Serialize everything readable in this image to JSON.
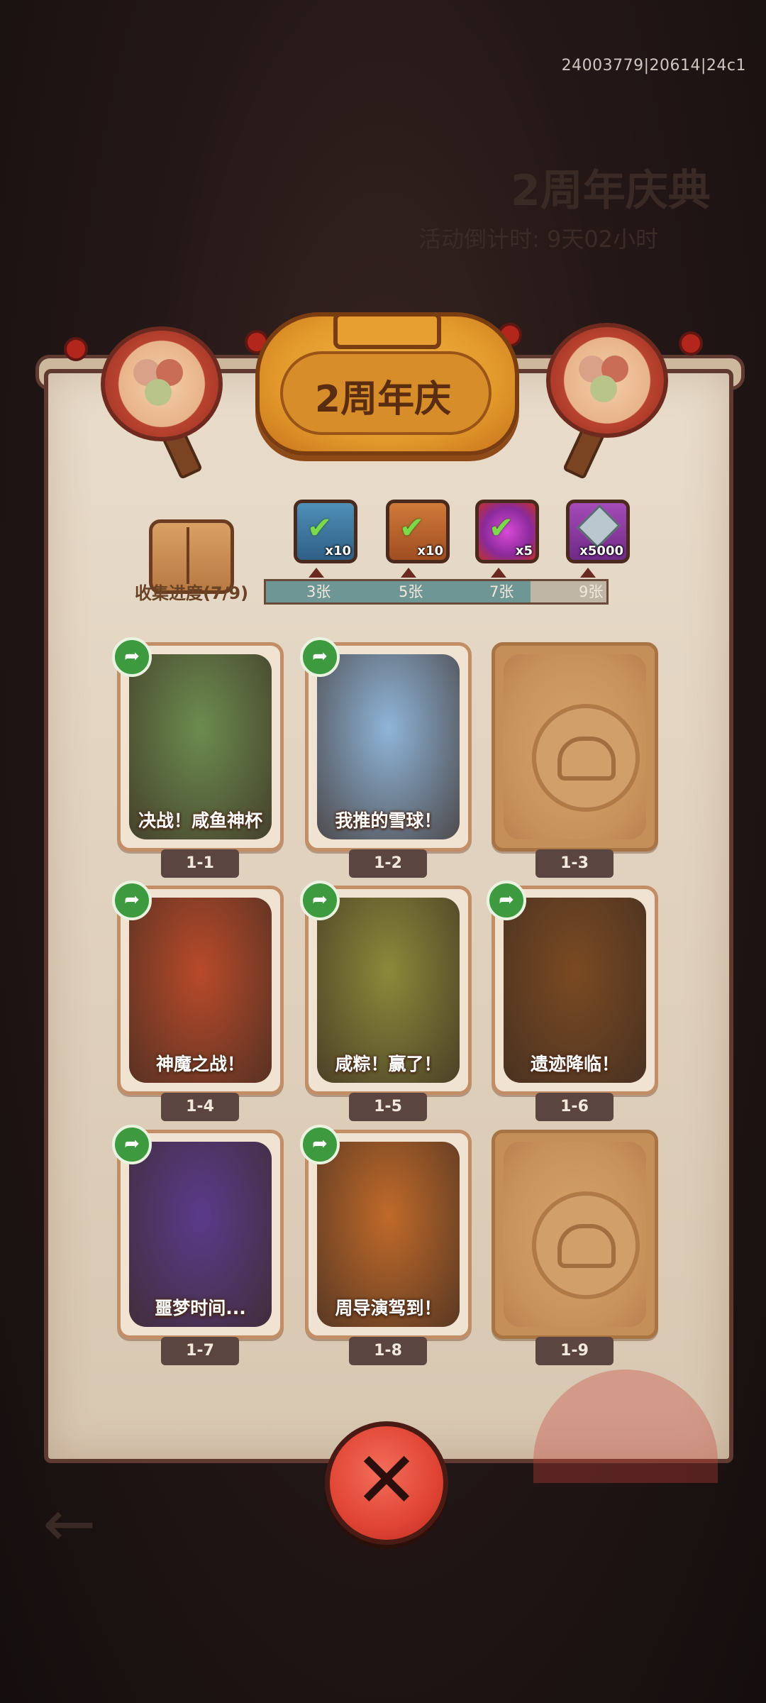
{
  "build_id": "24003779|20614|24c1",
  "background": {
    "title": "2周年庆典",
    "subtitle": "活动倒计时: 9天02小时"
  },
  "event_title": "2周年庆",
  "progress": {
    "label": "收集进度(7/9)",
    "collected": 7,
    "total": 9,
    "milestones": [
      {
        "label": "3张",
        "reward_qty": "x10",
        "claimed": true,
        "reward_icon": "blue-chest-check-icon"
      },
      {
        "label": "5张",
        "reward_qty": "x10",
        "claimed": true,
        "reward_icon": "orange-scroll-check-icon"
      },
      {
        "label": "7张",
        "reward_qty": "x5",
        "claimed": true,
        "reward_icon": "purple-orb-check-icon"
      },
      {
        "label": "9张",
        "reward_qty": "x5000",
        "claimed": false,
        "reward_icon": "purple-crystal-icon"
      }
    ]
  },
  "cards": [
    {
      "id": "1-1",
      "title": "决战！咸鱼神杯",
      "unlocked": true,
      "color": "#6c8c4f"
    },
    {
      "id": "1-2",
      "title": "我推的雪球！",
      "unlocked": true,
      "color": "#8fb5d8"
    },
    {
      "id": "1-3",
      "title": "",
      "unlocked": false,
      "color": "#c8925c"
    },
    {
      "id": "1-4",
      "title": "神魔之战！",
      "unlocked": true,
      "color": "#b84a2a"
    },
    {
      "id": "1-5",
      "title": "咸粽！赢了！",
      "unlocked": true,
      "color": "#8a8a3a"
    },
    {
      "id": "1-6",
      "title": "遗迹降临！",
      "unlocked": true,
      "color": "#7a4a22"
    },
    {
      "id": "1-7",
      "title": "噩梦时间...",
      "unlocked": true,
      "color": "#5a3a8a"
    },
    {
      "id": "1-8",
      "title": "周导演驾到！",
      "unlocked": true,
      "color": "#c06a2a"
    },
    {
      "id": "1-9",
      "title": "",
      "unlocked": false,
      "color": "#c8925c"
    }
  ],
  "close_icon": "close-x-icon"
}
